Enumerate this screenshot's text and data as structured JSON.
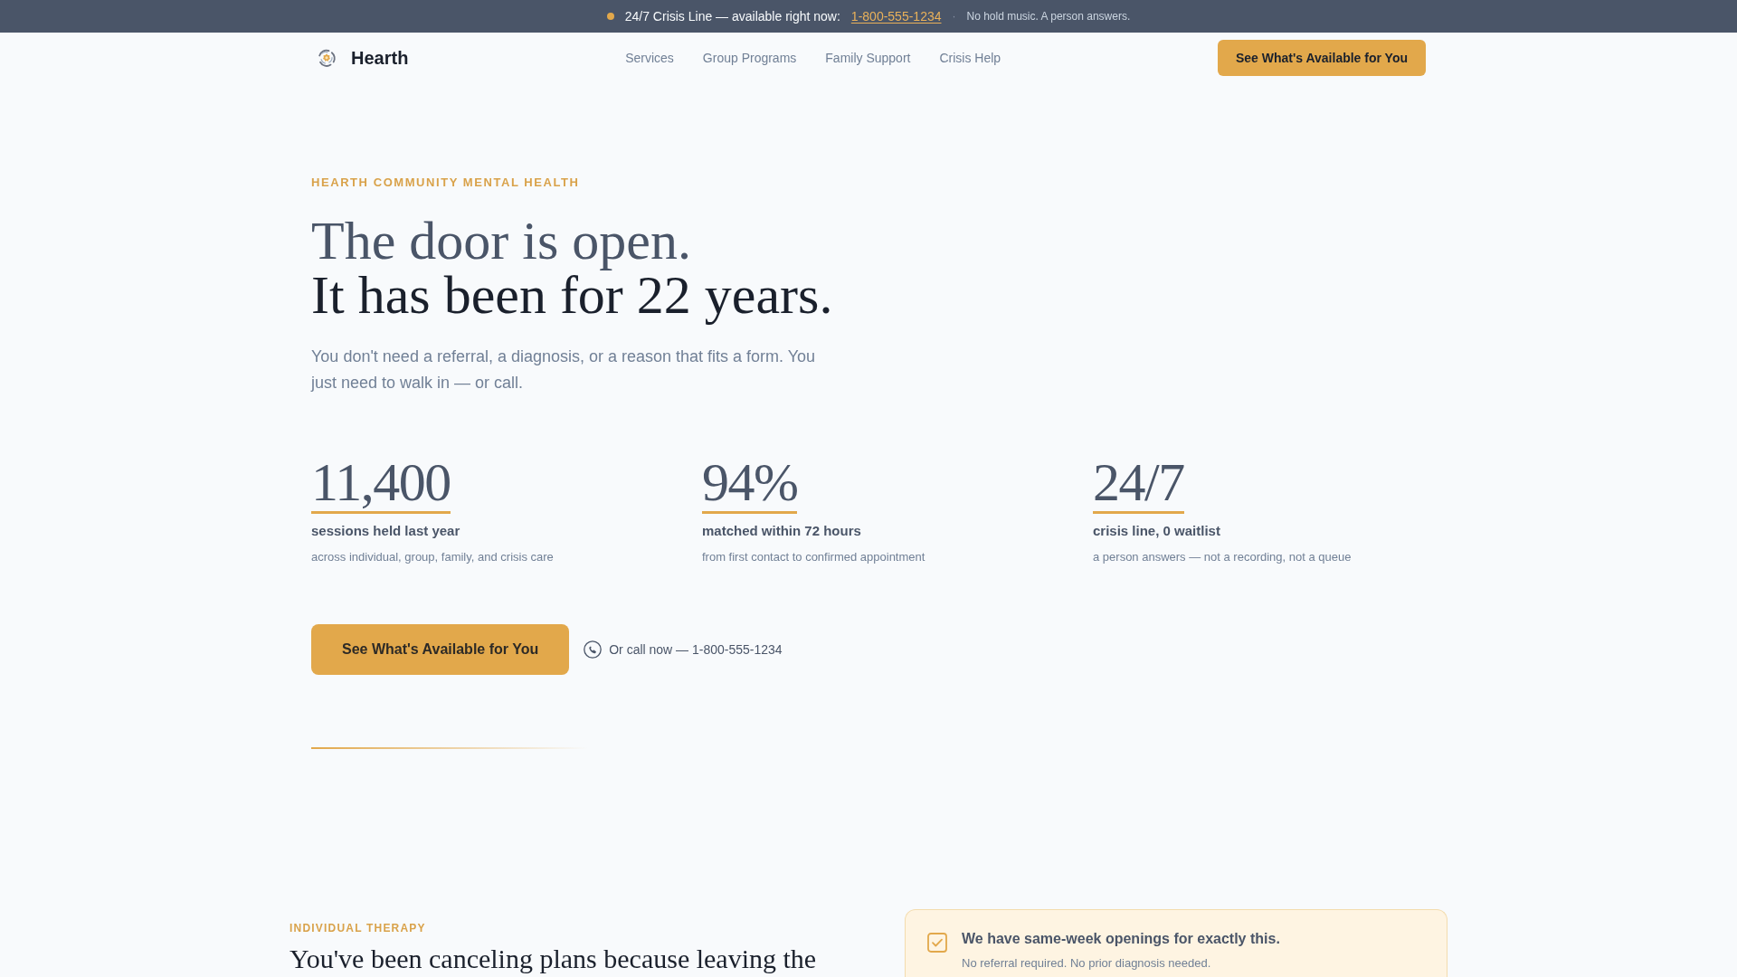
{
  "crisis_bar": {
    "label": "24/7 Crisis Line — available right now:",
    "phone": "1-800-555-1234",
    "separator": "·",
    "note": "No hold music. A person answers."
  },
  "nav": {
    "brand": "Hearth",
    "links": [
      "Services",
      "Group Programs",
      "Family Support",
      "Crisis Help"
    ],
    "cta": "See What's Available for You"
  },
  "hero": {
    "eyebrow": "HEARTH COMMUNITY MENTAL HEALTH",
    "title_lines": [
      "The door is open.",
      "It has been for 22 years."
    ],
    "lead": "You don't need a referral, a diagnosis, or a reason that fits a form. You just need to walk in — or call.",
    "stats": [
      {
        "value": "11,400",
        "label": "sessions held last year",
        "detail": "across individual, group, family, and crisis care"
      },
      {
        "value": "94%",
        "label": "matched within 72 hours",
        "detail": "from first contact to confirmed appointment"
      },
      {
        "value": "24/7",
        "label": "crisis line, 0 waitlist",
        "detail": "a person answers — not a recording, not a queue"
      }
    ],
    "cta": "See What's Available for You",
    "call": "Or call now — 1-800-555-1234"
  },
  "therapy_section": {
    "eyebrow": "INDIVIDUAL THERAPY",
    "heading": "You've been canceling plans because leaving the",
    "callout": {
      "title": "We have same-week openings for exactly this.",
      "text": "No referral required. No prior diagnosis needed."
    }
  }
}
